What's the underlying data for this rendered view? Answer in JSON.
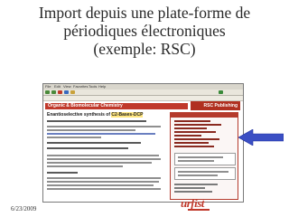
{
  "slide": {
    "title_lines": [
      "Import depuis une plate-forme de",
      "périodiques électroniques",
      "(exemple: RSC)"
    ],
    "date": "6/23/2009"
  },
  "screenshot": {
    "menu_items": [
      "File",
      "Edit",
      "View",
      "Favorites",
      "Tools",
      "Help"
    ],
    "journal_banner": "Organic & Biomolecular Chemistry",
    "publisher_logo": "RSC Publishing",
    "article_title": "Enantioselective synthesis of",
    "article_title_highlight": "C2-Bases-DCP"
  },
  "logo": {
    "text": "urfist"
  },
  "colors": {
    "title": "#2a2a2a",
    "rsc_red": "#b53a2c",
    "arrow_blue": "#3b4fc4",
    "logo_red": "#c0392b"
  }
}
